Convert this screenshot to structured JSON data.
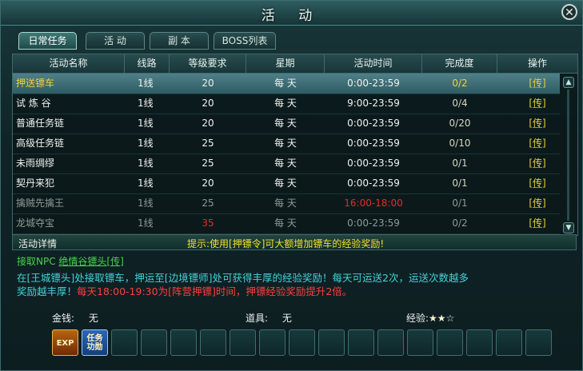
{
  "window": {
    "title": "活  动",
    "close_glyph": "✕"
  },
  "tabs": [
    {
      "label": "日常任务",
      "active": true
    },
    {
      "label": "活  动",
      "active": false
    },
    {
      "label": "副  本",
      "active": false
    },
    {
      "label": "BOSS列表",
      "active": false
    }
  ],
  "table": {
    "headers": [
      "活动名称",
      "线路",
      "等级要求",
      "星期",
      "活动时间",
      "完成度",
      "操作"
    ],
    "rows": [
      {
        "name": "押送镖车",
        "line": "1线",
        "level": "20",
        "week": "每 天",
        "time": "0:00-23:59",
        "progress": "0/2",
        "op": "[传]",
        "selected": true
      },
      {
        "name": "试 炼 谷",
        "line": "1线",
        "level": "20",
        "week": "每 天",
        "time": "9:00-23:59",
        "progress": "0/4",
        "op": "[传]"
      },
      {
        "name": "普通任务链",
        "line": "1线",
        "level": "20",
        "week": "每 天",
        "time": "0:00-23:59",
        "progress": "0/20",
        "op": "[传]"
      },
      {
        "name": "高级任务链",
        "line": "1线",
        "level": "25",
        "week": "每 天",
        "time": "0:00-23:59",
        "progress": "0/10",
        "op": "[传]"
      },
      {
        "name": "未雨绸缪",
        "line": "1线",
        "level": "25",
        "week": "每 天",
        "time": "0:00-23:59",
        "progress": "0/1",
        "op": "[传]"
      },
      {
        "name": "契丹来犯",
        "line": "1线",
        "level": "20",
        "week": "每 天",
        "time": "0:00-23:59",
        "progress": "0/1",
        "op": "[传]"
      },
      {
        "name": "擒贼先擒王",
        "line": "1线",
        "level": "25",
        "week": "每 天",
        "time": "16:00-18:00",
        "progress": "0/1",
        "op": "[传]",
        "dim": true,
        "time_red": true
      },
      {
        "name": "龙城夺宝",
        "line": "1线",
        "level": "35",
        "week": "每 天",
        "time": "0:00-23:59",
        "progress": "0/2",
        "op": "[传]",
        "dim": true,
        "level_red": true
      }
    ]
  },
  "detail": {
    "label": "活动详情",
    "hint": "提示:使用[押镖令]可大额增加镖车的经验奖励!",
    "npc_prefix": "接取NPC",
    "npc_link": "绝情谷镖头[传]",
    "desc_line1": "在[王城镖头]处接取镖车，押运至[边境镖师]处可获得丰厚的经验奖励！每天可运送2次，运送次数越多",
    "desc_line2a": "奖励越丰厚！",
    "desc_line2b": "每天18:00-19:30为[阵营押镖]时间，押镖经验奖励提升2倍。"
  },
  "rewards": {
    "money_label": "金钱:",
    "money_value": "无",
    "item_label": "道具:",
    "item_value": "无",
    "exp_label": "经验:",
    "exp_stars": "★★☆"
  },
  "slots": {
    "icon1_text": "EXP",
    "icon2_text": "任务功勋"
  },
  "colors": {
    "accent_yellow": "#f4d02f",
    "text_cyan": "#43d3da",
    "npc_green": "#48d34d",
    "warn_red": "#e32b2b"
  }
}
